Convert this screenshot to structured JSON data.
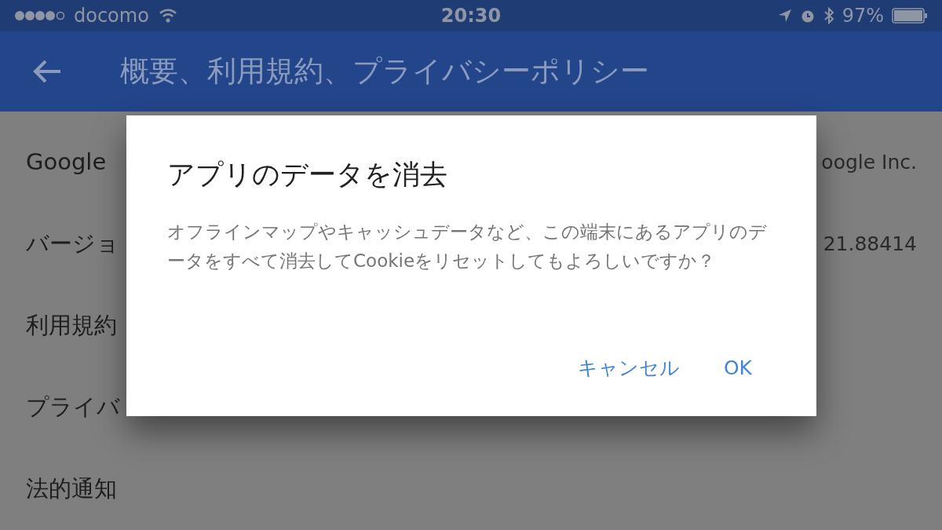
{
  "status_bar": {
    "carrier": "docomo",
    "time": "20:30",
    "battery": "97%"
  },
  "app_bar": {
    "title": "概要、利用規約、プライバシーポリシー"
  },
  "list": [
    {
      "label": "Google",
      "value": "oogle Inc."
    },
    {
      "label": "バージョ",
      "value": "21.88414"
    },
    {
      "label": "利用規約"
    },
    {
      "label": "プライバ"
    },
    {
      "label": "法的通知"
    }
  ],
  "dialog": {
    "title": "アプリのデータを消去",
    "message": "オフラインマップやキャッシュデータなど、この端末にあるアプリのデータをすべて消去してCookieをリセットしてもよろしいですか？",
    "buttons": [
      "キャンセル",
      "OK"
    ]
  }
}
